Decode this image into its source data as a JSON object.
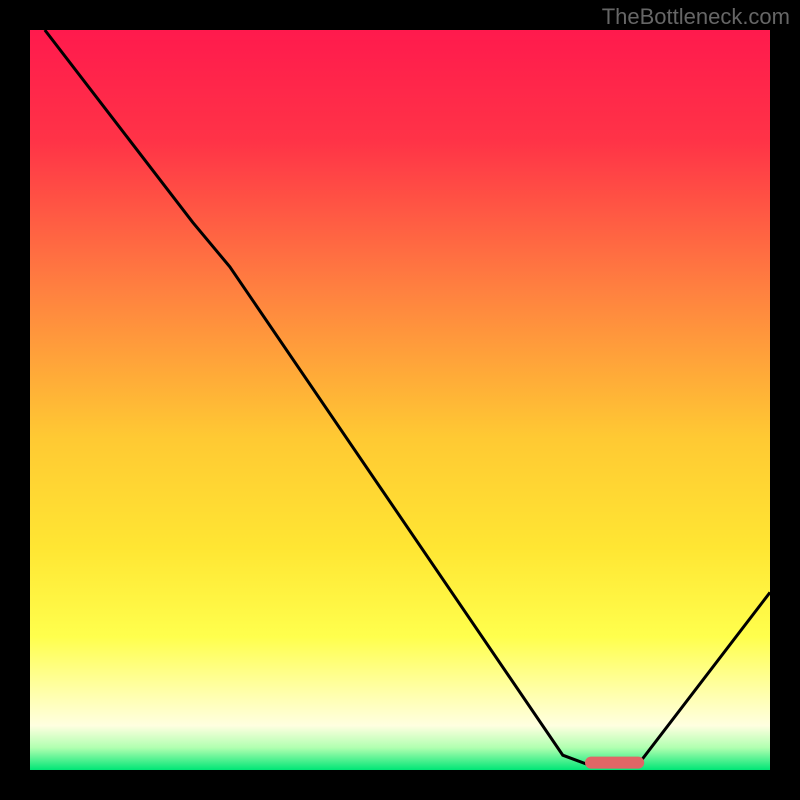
{
  "watermark": "TheBottleneck.com",
  "chart_data": {
    "type": "line",
    "title": "",
    "xlabel": "",
    "ylabel": "",
    "xlim": [
      0,
      100
    ],
    "ylim": [
      0,
      100
    ],
    "gradient_stops": [
      {
        "offset": 0,
        "color": "#ff1a4d"
      },
      {
        "offset": 0.15,
        "color": "#ff3347"
      },
      {
        "offset": 0.35,
        "color": "#ff8040"
      },
      {
        "offset": 0.55,
        "color": "#ffc933"
      },
      {
        "offset": 0.7,
        "color": "#ffe633"
      },
      {
        "offset": 0.82,
        "color": "#ffff4d"
      },
      {
        "offset": 0.9,
        "color": "#ffffb0"
      },
      {
        "offset": 0.94,
        "color": "#ffffe0"
      },
      {
        "offset": 0.97,
        "color": "#b0ffb0"
      },
      {
        "offset": 1.0,
        "color": "#00e676"
      }
    ],
    "series": [
      {
        "name": "curve",
        "color": "#000000",
        "points": [
          {
            "x": 2,
            "y": 100
          },
          {
            "x": 22,
            "y": 74
          },
          {
            "x": 27,
            "y": 68
          },
          {
            "x": 72,
            "y": 2
          },
          {
            "x": 76,
            "y": 0.5
          },
          {
            "x": 82,
            "y": 0.5
          },
          {
            "x": 100,
            "y": 24
          }
        ]
      }
    ],
    "marker": {
      "x_start": 75,
      "x_end": 83,
      "y": 1,
      "color": "#e06666"
    }
  }
}
